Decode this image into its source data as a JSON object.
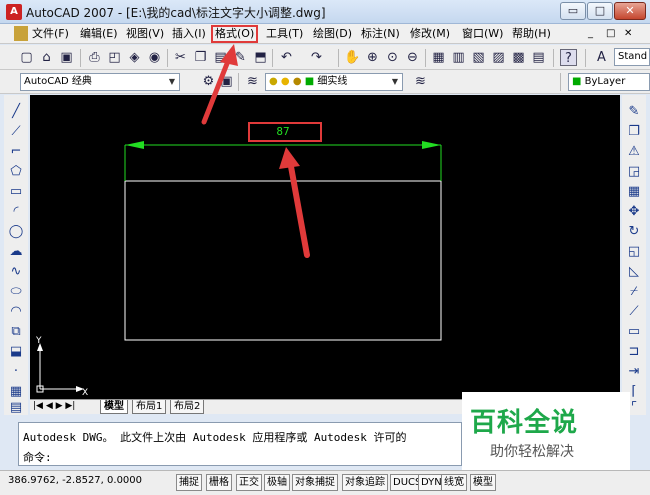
{
  "window": {
    "app_icon": "A",
    "title": "AutoCAD 2007 - [E:\\我的cad\\标注文字大小调整.dwg]",
    "buttons": {
      "minimize": "▭",
      "maximize": "□",
      "close": "✕"
    }
  },
  "menubar": {
    "items": [
      "文件(F)",
      "编辑(E)",
      "视图(V)",
      "插入(I)",
      "格式(O)",
      "工具(T)",
      "绘图(D)",
      "标注(N)",
      "修改(M)",
      "窗口(W)",
      "帮助(H)"
    ],
    "highlighted": "格式(O)",
    "doc_buttons": [
      "_",
      "□",
      "✕"
    ]
  },
  "toolbar": {
    "style_combo": "Stand"
  },
  "toolbar2": {
    "workspace": "AutoCAD 经典",
    "layer_color": "0",
    "linetype": "细实线",
    "lineweight": "ByLayer"
  },
  "drawing": {
    "dimension_text": "87",
    "ucs_x": "X",
    "ucs_y": "Y"
  },
  "tabs": {
    "items": [
      "模型",
      "布局1",
      "布局2"
    ],
    "active": "模型"
  },
  "command": {
    "history": "Autodesk DWG。  此文件上次由 Autodesk 应用程序或 Autodesk 许可的",
    "prompt": "命令:"
  },
  "status": {
    "coords": "386.9762, -2.8527, 0.0000",
    "toggles": [
      "捕捉",
      "栅格",
      "正交",
      "极轴",
      "对象捕捉",
      "对象追踪",
      "DUCS",
      "DYN",
      "线宽",
      "模型"
    ]
  },
  "watermark": {
    "title": "百科全说",
    "subtitle": "助你轻松解决"
  },
  "colors": {
    "annotation_red": "#e03a3a",
    "dimension_green": "#22dd22",
    "canvas_bg": "#000000"
  }
}
